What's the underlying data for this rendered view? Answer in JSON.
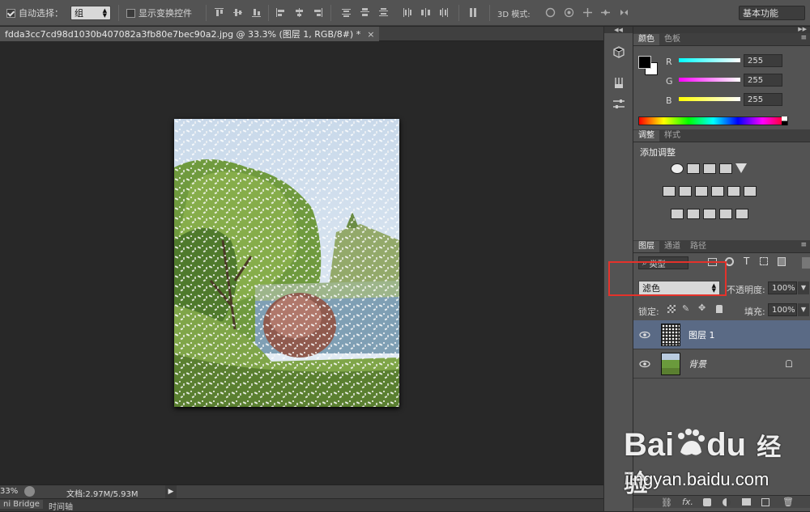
{
  "options_bar": {
    "auto_select_label": "自动选择：",
    "auto_select_value": "组",
    "show_transform_label": "显示变换控件",
    "mode_3d_label": "3D 模式:",
    "workspace_value": "基本功能"
  },
  "document": {
    "tab_title": "fdda3cc7cd98d1030b407082a3fb80e7bec90a2.jpg @ 33.3% (图层 1, RGB/8#) *",
    "tab_close": "×"
  },
  "status": {
    "zoom": "33%",
    "doc_info": "文档:2.97M/5.93M",
    "bottom_tab_bridge": "ni Bridge",
    "bottom_tab_timeline": "时间轴"
  },
  "color_panel": {
    "tabs": [
      "颜色",
      "色板"
    ],
    "channels": [
      {
        "name": "R",
        "value": "255"
      },
      {
        "name": "G",
        "value": "255"
      },
      {
        "name": "B",
        "value": "255"
      }
    ]
  },
  "adjust_panel": {
    "tabs": [
      "调整",
      "样式"
    ],
    "title": "添加调整"
  },
  "layers_panel": {
    "tabs": [
      "图层",
      "通道",
      "路径"
    ],
    "filter_kind": "类型",
    "blend_mode": "滤色",
    "opacity_label": "不透明度:",
    "opacity_value": "100%",
    "lock_label": "锁定:",
    "fill_label": "填充:",
    "fill_value": "100%",
    "layers": [
      {
        "name": "图层 1"
      },
      {
        "name": "背景"
      }
    ],
    "footer_fx": "fx."
  },
  "watermark": {
    "brand": "Bai",
    "brand2": "du",
    "brand_cn": "经验",
    "url": "jingyan.baidu.com"
  },
  "colors": {
    "accent_highlight": "#e4322b",
    "selected_layer": "#5a6a85"
  }
}
